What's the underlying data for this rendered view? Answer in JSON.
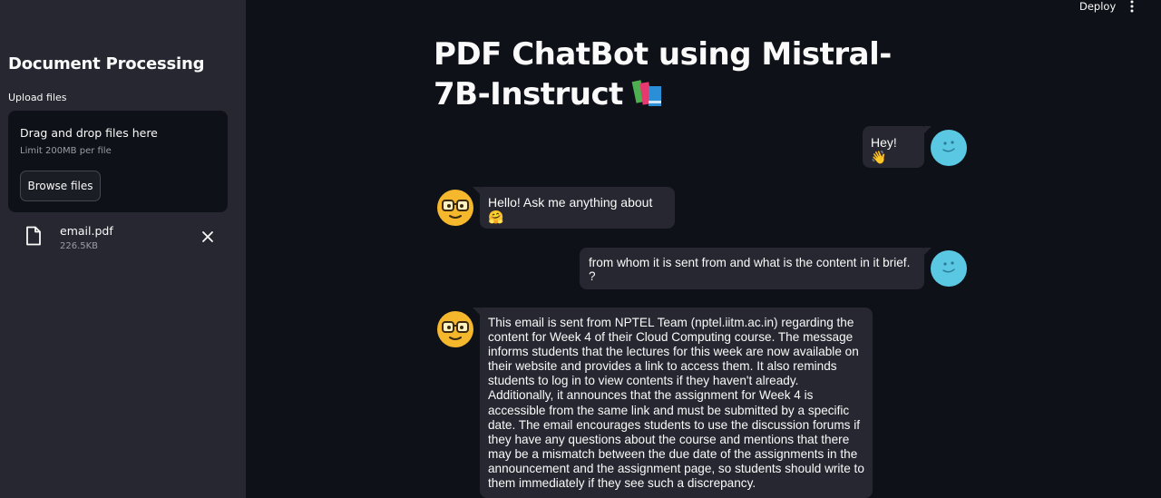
{
  "sidebar": {
    "title": "Document Processing",
    "upload_label": "Upload files",
    "dropzone": {
      "title": "Drag and drop files here",
      "limit": "Limit 200MB per file",
      "browse_label": "Browse files"
    },
    "files": [
      {
        "name": "email.pdf",
        "size": "226.5KB"
      }
    ]
  },
  "header": {
    "deploy_label": "Deploy",
    "menu_icon": "vertical-dots-icon"
  },
  "main": {
    "title": "PDF ChatBot using Mistral-7B-Instruct",
    "title_icon": "books-icon",
    "messages": [
      {
        "role": "user",
        "text": "Hey! 👋"
      },
      {
        "role": "assistant",
        "text": "Hello! Ask me anything about 🤗"
      },
      {
        "role": "user",
        "text": "from whom it is sent from and what is the content in it brief. ?"
      },
      {
        "role": "assistant",
        "text": "This email is sent from NPTEL Team (nptel.iitm.ac.in) regarding the content for Week 4 of their Cloud Computing course. The message informs students that the lectures for this week are now available on their website and provides a link to access them. It also reminds students to log in to view contents if they haven't already. Additionally, it announces that the assignment for Week 4 is accessible from the same link and must be submitted by a specific date. The email encourages students to use the discussion forums if they have any questions about the course and mentions that there may be a mismatch between the due date of the assignments in the announcement and the assignment page, so students should write to them immediately if they see such a discrepancy."
      }
    ]
  },
  "colors": {
    "background": "#0e1117",
    "sidebar": "#262730",
    "bubble": "#262730",
    "user_avatar": "#5bc8e3",
    "bot_avatar": "#f5b72b"
  }
}
